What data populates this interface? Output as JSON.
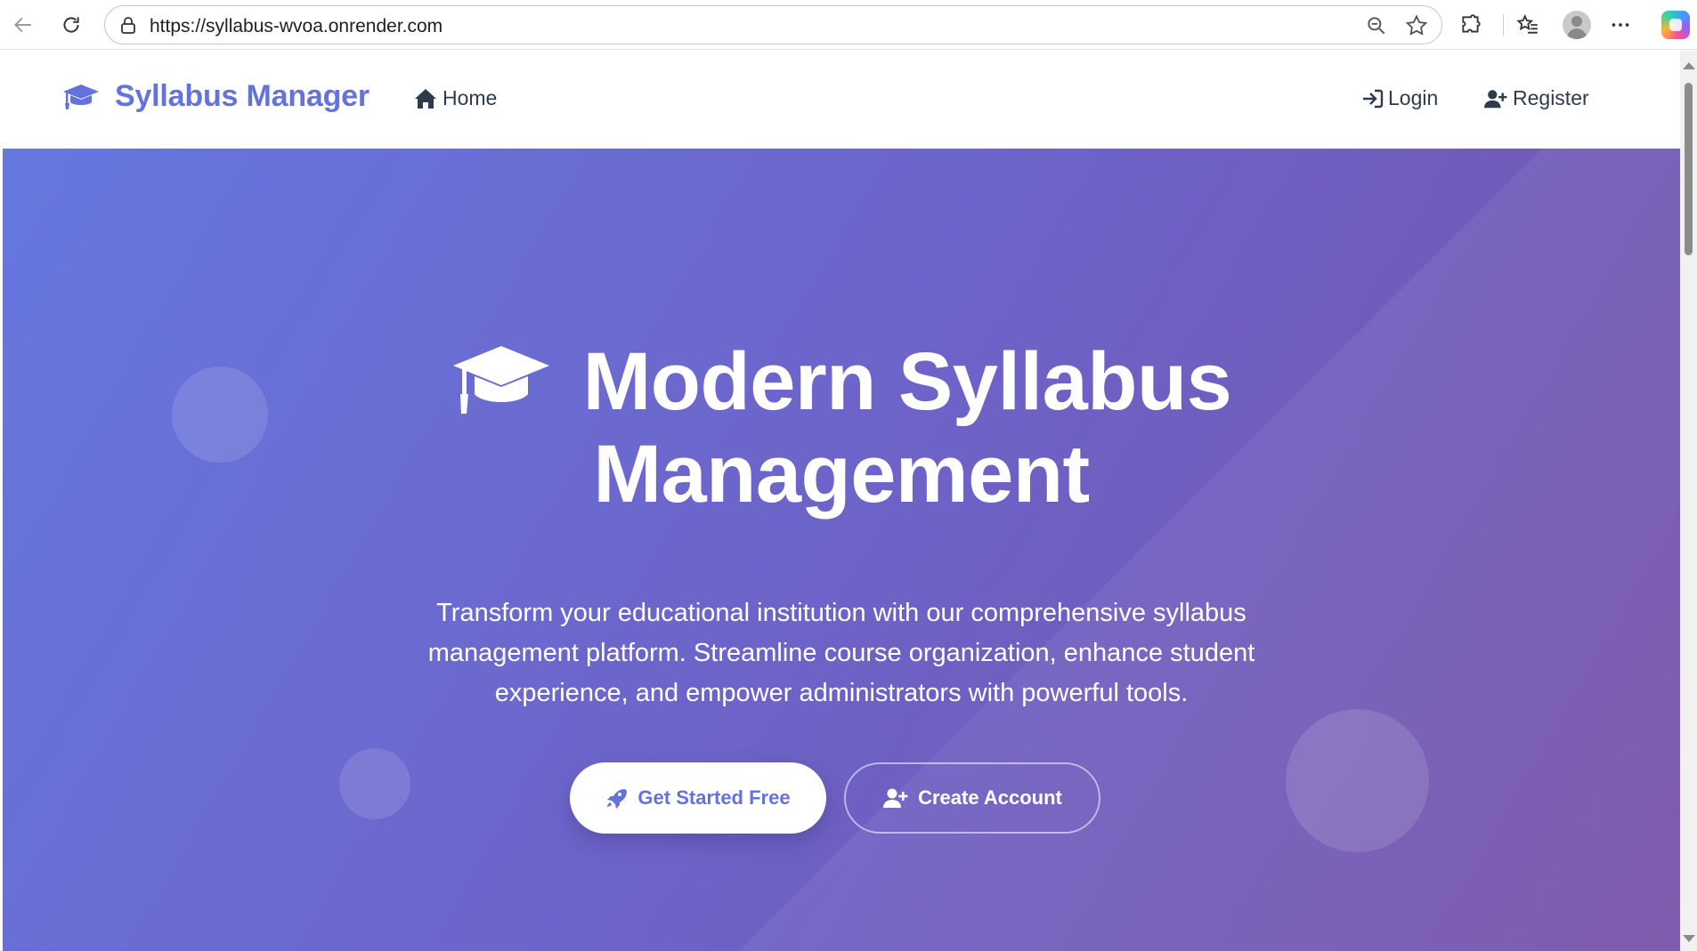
{
  "browser": {
    "url": "https://syllabus-wvoa.onrender.com",
    "icons": [
      "back-icon",
      "reload-icon",
      "lock-icon",
      "zoom-out-icon",
      "favorite-star-icon",
      "extensions-icon",
      "favorites-icon",
      "profile-avatar",
      "more-icon",
      "copilot-icon"
    ]
  },
  "navbar": {
    "brand": "Syllabus Manager",
    "home": "Home",
    "login": "Login",
    "register": "Register",
    "brand_color": "#6472dc"
  },
  "hero": {
    "title_line1": "Modern Syllabus",
    "title_line2": "Management",
    "description": "Transform your educational institution with our comprehensive syllabus management platform. Streamline course organization, enhance student experience, and empower administrators with powerful tools.",
    "primary_button": "Get Started Free",
    "secondary_button": "Create Account",
    "gradient_start": "#6678e0",
    "gradient_end": "#7651a8"
  }
}
